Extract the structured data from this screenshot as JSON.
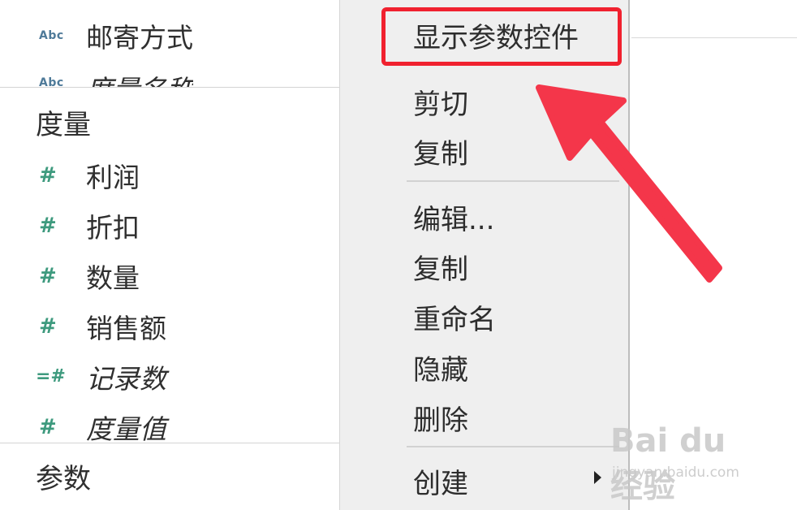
{
  "left_pane": {
    "dimensions_partial": [
      {
        "icon": "Abc",
        "label": "邮寄方式"
      },
      {
        "icon": "Abc",
        "label": "度量名称"
      }
    ],
    "measures_title": "度量",
    "measures": [
      {
        "icon": "#",
        "label": "利润",
        "italic": false
      },
      {
        "icon": "#",
        "label": "折扣",
        "italic": false
      },
      {
        "icon": "#",
        "label": "数量",
        "italic": false
      },
      {
        "icon": "#",
        "label": "销售额",
        "italic": false
      },
      {
        "icon": "=#",
        "label": "记录数",
        "italic": true
      },
      {
        "icon": "#",
        "label": "度量值",
        "italic": true
      }
    ],
    "parameters_title": "参数"
  },
  "context_menu": {
    "items": [
      {
        "label": "显示参数控件",
        "highlighted": true
      },
      {
        "label": "剪切"
      },
      {
        "label": "复制"
      },
      {
        "label": "编辑..."
      },
      {
        "label": "复制"
      },
      {
        "label": "重命名"
      },
      {
        "label": "隐藏"
      },
      {
        "label": "删除"
      },
      {
        "label": "创建",
        "has_submenu": true
      }
    ]
  },
  "annotation": {
    "highlight_color": "#f0212f",
    "arrow_color": "#f4364a"
  },
  "watermark": {
    "logo": "Bai du 经验",
    "url": "jingyan.baidu.com"
  }
}
